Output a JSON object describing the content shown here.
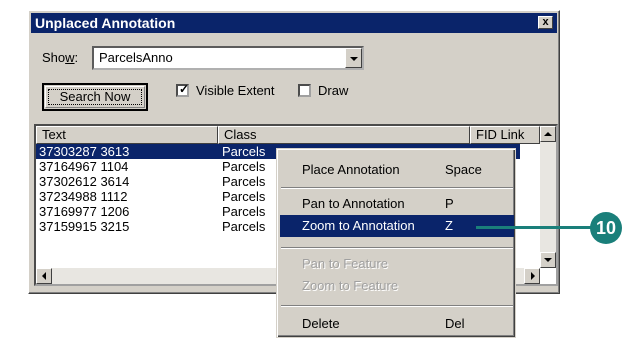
{
  "window": {
    "title": "Unplaced Annotation",
    "close_label": "x"
  },
  "show": {
    "label_prefix": "Sho",
    "label_underline": "w",
    "label_suffix": ":",
    "value": "ParcelsAnno"
  },
  "search_button": {
    "label": "Search Now"
  },
  "visible_extent": {
    "label": "Visible Extent",
    "checked": true
  },
  "draw": {
    "label": "Draw",
    "checked": false
  },
  "table": {
    "columns": [
      "Text",
      "Class",
      "FID Link"
    ],
    "rows": [
      {
        "text": "37303287 3613",
        "class": "Parcels"
      },
      {
        "text": "37164967 1104",
        "class": "Parcels"
      },
      {
        "text": "37302612 3614",
        "class": "Parcels"
      },
      {
        "text": "37234988 1112",
        "class": "Parcels"
      },
      {
        "text": "37169977 1206",
        "class": "Parcels"
      },
      {
        "text": "37159915 3215",
        "class": "Parcels"
      }
    ]
  },
  "context_menu": {
    "items": [
      {
        "label": "Place Annotation",
        "key": "Space"
      },
      {
        "label": "Pan to Annotation",
        "key": "P"
      },
      {
        "label": "Zoom to Annotation",
        "key": "Z"
      },
      {
        "label": "Pan to Feature",
        "key": ""
      },
      {
        "label": "Zoom to Feature",
        "key": ""
      },
      {
        "label": "Delete",
        "key": "Del"
      }
    ]
  },
  "callout": {
    "number": "10",
    "color": "#1a7f7a"
  }
}
